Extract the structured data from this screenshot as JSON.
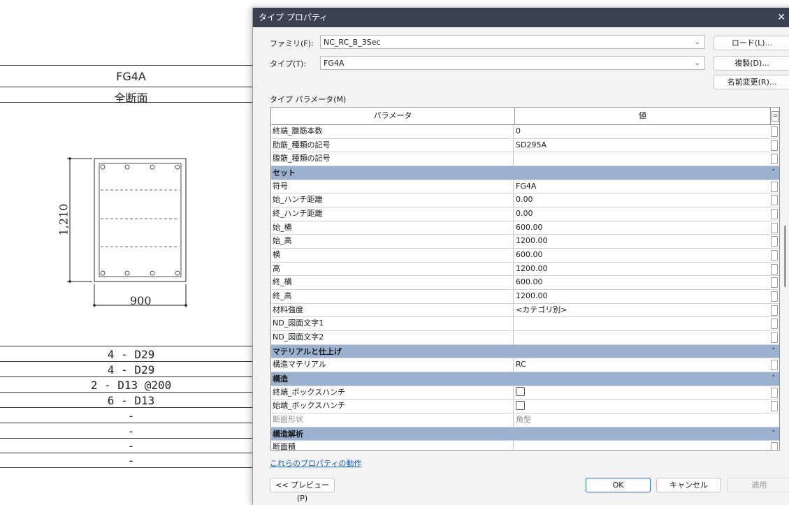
{
  "sheet": {
    "header_row1": "FG4A",
    "header_row2": "全断面",
    "dimension_height": "1,210",
    "dimension_width": "900",
    "bar_rows": [
      "4 - D29",
      "4 - D29",
      "2 - D13 @200",
      "6 - D13",
      "-",
      "-",
      "-",
      "-"
    ]
  },
  "dialog": {
    "title": "タイプ プロパティ",
    "close_glyph": "✕",
    "family_label": "ファミリ(F):",
    "family_value": "NC_RC_B_3Sec",
    "type_label": "タイプ(T):",
    "type_value": "FG4A",
    "load_button": "ロード(L)...",
    "duplicate_button": "複製(D)...",
    "rename_button": "名前変更(R)...",
    "type_params_label": "タイプ パラメータ(M)",
    "col_parameter": "パラメータ",
    "col_value": "値",
    "col_extra": "=",
    "chevron": "⌄",
    "collapse_glyph": "˄",
    "rows_top": [
      {
        "param": "終端_腹筋本数",
        "value": "0"
      },
      {
        "param": "肋筋_種類の記号",
        "value": "SD295A"
      },
      {
        "param": "腹筋_種類の記号",
        "value": ""
      }
    ],
    "group_set": "セット",
    "rows_set": [
      {
        "param": "符号",
        "value": "FG4A"
      },
      {
        "param": "始_ハンチ距離",
        "value": "0.00"
      },
      {
        "param": "終_ハンチ距離",
        "value": "0.00"
      },
      {
        "param": "始_横",
        "value": "600.00"
      },
      {
        "param": "始_高",
        "value": "1200.00"
      },
      {
        "param": "横",
        "value": "600.00"
      },
      {
        "param": "高",
        "value": "1200.00"
      },
      {
        "param": "終_横",
        "value": "600.00"
      },
      {
        "param": "終_高",
        "value": "1200.00"
      },
      {
        "param": "材料強度",
        "value": "<カテゴリ別>"
      },
      {
        "param": "ND_図面文字1",
        "value": ""
      },
      {
        "param": "ND_図面文字2",
        "value": ""
      }
    ],
    "group_material": "マテリアルと仕上げ",
    "rows_material": [
      {
        "param": "構造マテリアル",
        "value": "RC"
      }
    ],
    "group_structure": "構造",
    "rows_structure": [
      {
        "param": "終端_ボックスハンチ",
        "value": ""
      },
      {
        "param": "始端_ボックスハンチ",
        "value": ""
      },
      {
        "param": "断面形状",
        "value": "角型"
      }
    ],
    "group_analysis": "構造解析",
    "rows_analysis": [
      {
        "param": "断面積",
        "value": ""
      }
    ],
    "link_text": "これらのプロパティの動作",
    "preview_button": "<< プレビュー(P)",
    "ok_button": "OK",
    "cancel_button": "キャンセル",
    "apply_button": "適用"
  }
}
